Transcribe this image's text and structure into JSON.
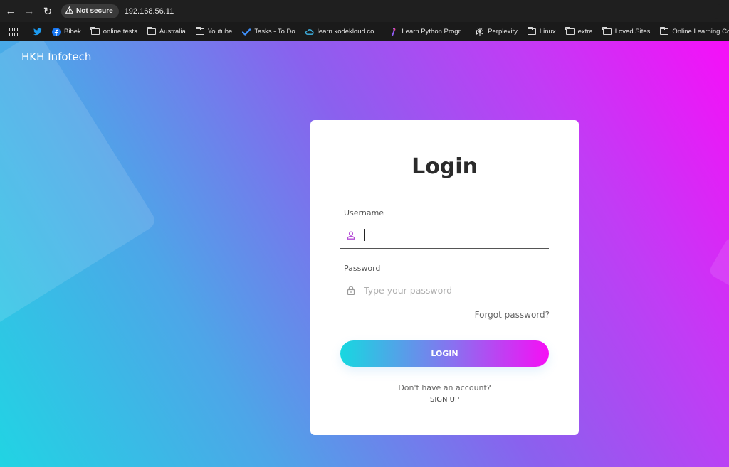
{
  "browser": {
    "security_label": "Not secure",
    "url": "192.168.56.11"
  },
  "bookmarks": [
    {
      "label": "Bibek",
      "icon": "facebook-icon"
    },
    {
      "label": "online tests",
      "icon": "folder-icon"
    },
    {
      "label": "Australia",
      "icon": "folder-icon"
    },
    {
      "label": "Youtube",
      "icon": "folder-icon"
    },
    {
      "label": "Tasks - To Do",
      "icon": "todo-check-icon"
    },
    {
      "label": "learn.kodekloud.co...",
      "icon": "kodekloud-icon"
    },
    {
      "label": "Learn Python Progr...",
      "icon": "python-icon"
    },
    {
      "label": "Perplexity",
      "icon": "perplexity-icon"
    },
    {
      "label": "Linux",
      "icon": "folder-icon"
    },
    {
      "label": "extra",
      "icon": "folder-icon"
    },
    {
      "label": "Loved Sites",
      "icon": "folder-icon"
    },
    {
      "label": "Online Learning Co...",
      "icon": "folder-icon"
    }
  ],
  "brand": "HKH Infotech",
  "login": {
    "title": "Login",
    "username_label": "Username",
    "username_value": "",
    "password_label": "Password",
    "password_placeholder": "Type your password",
    "forgot_password": "Forgot password?",
    "login_button": "LOGIN",
    "no_account": "Don't have an account?",
    "signup": "SIGN UP"
  },
  "colors": {
    "gradient_start": "#21d4e3",
    "gradient_end": "#f60ff8",
    "icon_accent": "#b44bd6"
  }
}
